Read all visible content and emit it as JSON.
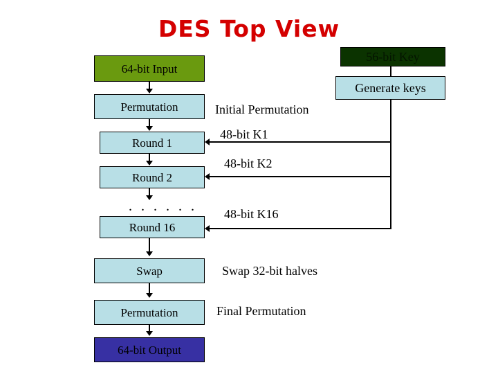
{
  "slide": {
    "title": "DES Top View",
    "title_color": "#d40000",
    "background": "#ffffff"
  },
  "colors": {
    "box_blue": "#b8dfe6",
    "box_green": "#6a9a0f",
    "box_dark_green": "#0b3300",
    "box_indigo": "#3730a3",
    "border": "#000000"
  },
  "data_path": {
    "boxes": [
      {
        "label": "64-bit Input",
        "fill": "green"
      },
      {
        "label": "Permutation",
        "fill": "blue"
      },
      {
        "label": "Round 1",
        "fill": "blue"
      },
      {
        "label": "Round 2",
        "fill": "blue"
      },
      {
        "label": "Round 16",
        "fill": "blue"
      },
      {
        "label": "Swap",
        "fill": "blue"
      },
      {
        "label": "Permutation",
        "fill": "blue"
      },
      {
        "label": "64-bit Output",
        "fill": "indigo"
      }
    ],
    "ellipsis": ". . . . . ."
  },
  "key_path": {
    "boxes": [
      {
        "label": "56-bit Key",
        "fill": "darkgreen"
      },
      {
        "label": "Generate keys",
        "fill": "blue"
      }
    ]
  },
  "annotations": {
    "initial_permutation": "Initial Permutation",
    "k1": "48-bit K1",
    "k2": "48-bit K2",
    "k16": "48-bit K16",
    "swap_halves": "Swap 32-bit halves",
    "final_permutation": "Final Permutation"
  }
}
